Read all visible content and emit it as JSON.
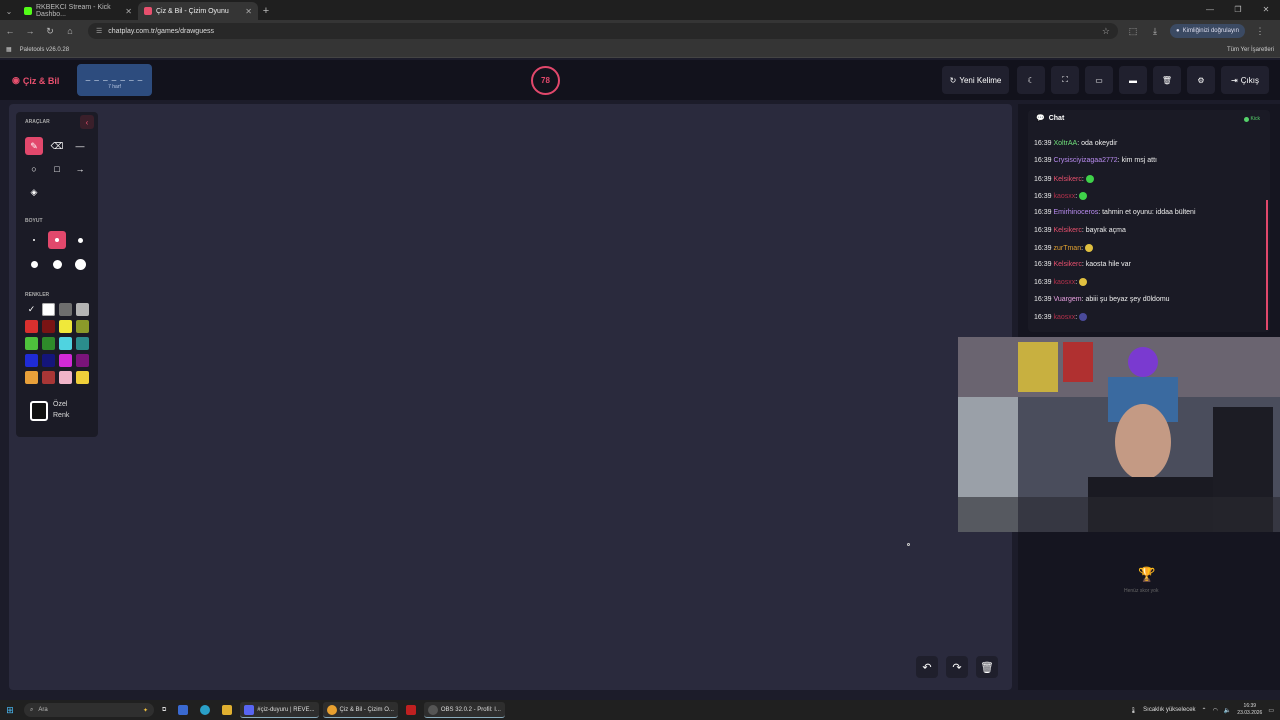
{
  "browser": {
    "tabs": [
      {
        "title": "RKBEKCI Stream - Kick Dashbo...",
        "active": false,
        "favicon_color": "#53fc18"
      },
      {
        "title": "Çiz & Bil - Çizim Oyunu",
        "active": true,
        "favicon_color": "#e8506e"
      }
    ],
    "url": "chatplay.com.tr/games/drawguess",
    "profile_label": "Kimliğinizi doğrulayın",
    "bookmark": "Paletools v26.0.28",
    "all_bookmarks": "Tüm Yer İşaretleri"
  },
  "header": {
    "logo": "Çiz & Bil",
    "word_mask": "_ _ _ _ _ _ _",
    "word_length": "7 harf",
    "timer": "78",
    "new_word_button": "Yeni Kelime",
    "logout_button": "Çıkış"
  },
  "tools": {
    "section_tools": "ARAÇLAR",
    "section_size": "BOYUT",
    "section_colors": "RENKLER",
    "custom_color_line1": "Özel",
    "custom_color_line2": "Renk",
    "selected_tool": "pencil",
    "selected_size_index": 1,
    "selected_color": "#111111",
    "colors": [
      "#111111",
      "#ffffff",
      "#6e6e6e",
      "#b4b4b4",
      "#d9302e",
      "#7a1414",
      "#f0e83a",
      "#8b9a2a",
      "#4ec23c",
      "#2e8a2a",
      "#4fd3e0",
      "#2b8c8c",
      "#1f2bd6",
      "#14157a",
      "#d22ad6",
      "#7a147a",
      "#e8a03a",
      "#a83636",
      "#f0b4c8",
      "#f0d03a"
    ]
  },
  "chat": {
    "title": "Chat",
    "platform_status": "Kick",
    "messages": [
      {
        "time": "16:39",
        "user": "XoltrAA",
        "user_color": "#6fe07a",
        "text": "oda okeydir"
      },
      {
        "time": "16:39",
        "user": "Crysisciyizagaa2772",
        "user_color": "#b98cf0",
        "text": "kim msj attı"
      },
      {
        "time": "16:39",
        "user": "Kelsikerc",
        "user_color": "#e8506e",
        "text": "",
        "emoji": "#3fd24a"
      },
      {
        "time": "16:39",
        "user": "kaosxx",
        "user_color": "#b0304a",
        "text": "",
        "emoji": "#3fd24a"
      },
      {
        "time": "16:39",
        "user": "Emirhinoceros",
        "user_color": "#b98cf0",
        "text": "tahmin et oyunu: iddaa bülteni"
      },
      {
        "time": "16:39",
        "user": "Kelsikerc",
        "user_color": "#e8506e",
        "text": "bayrak açma"
      },
      {
        "time": "16:39",
        "user": "zurTman",
        "user_color": "#e0a030",
        "text": "",
        "emoji": "#e0c040"
      },
      {
        "time": "16:39",
        "user": "Kelsikerc",
        "user_color": "#e8506e",
        "text": "kaosta hile var"
      },
      {
        "time": "16:39",
        "user": "kaosxx",
        "user_color": "#b0304a",
        "text": "",
        "emoji": "#e0c040"
      },
      {
        "time": "16:39",
        "user": "Vuargem",
        "user_color": "#e8a0e0",
        "text": "abiii şu beyaz şey d0ldomu"
      },
      {
        "time": "16:39",
        "user": "kaosxx",
        "user_color": "#b0304a",
        "text": "",
        "emoji": "#4a4a9a"
      }
    ]
  },
  "scoreboard": {
    "empty_text": "Henüz skor yok"
  },
  "taskbar": {
    "search_placeholder": "Ara",
    "apps": [
      {
        "label": "#çiz-duyuru | REVE...",
        "color": "#5865f2"
      },
      {
        "label": "Çiz & Bil - Çizim O...",
        "color": "#e8a030"
      },
      {
        "label": "OBS 32.0.2 - Profil: I...",
        "color": "#302e31"
      }
    ],
    "weather": "Sıcaklık yükselecek",
    "time": "16:39",
    "date": "23.03.2026"
  }
}
